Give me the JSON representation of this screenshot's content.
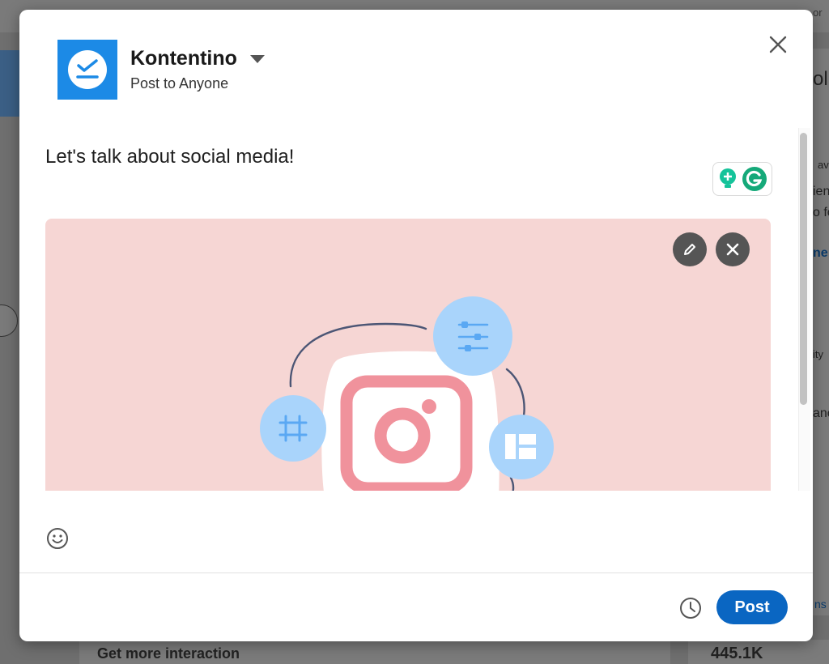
{
  "modal": {
    "author_name": "Kontentino",
    "audience": "Post to Anyone",
    "post_text": "Let's talk about social media!",
    "post_button": "Post"
  },
  "background": {
    "right_fragments": [
      "ol",
      "av",
      "ien",
      "o fo",
      "ne",
      "ity",
      "anc",
      "ns"
    ],
    "top_right_fragment": "or",
    "bottom_left_text": "Get more interaction",
    "bottom_right_text": "445.1K"
  },
  "colors": {
    "brand_blue": "#1c8ae6",
    "post_button": "#0a66c2",
    "media_background": "#f6d6d4",
    "instagram_pink": "#f0929c",
    "bubble_blue": "#a9d4fb"
  },
  "icons": {
    "close": "close-icon",
    "caret": "caret-down-icon",
    "edit_media": "pencil-icon",
    "remove_media": "close-icon",
    "emoji": "smiley-icon",
    "schedule": "clock-icon",
    "grammarly": "grammarly-icon"
  }
}
